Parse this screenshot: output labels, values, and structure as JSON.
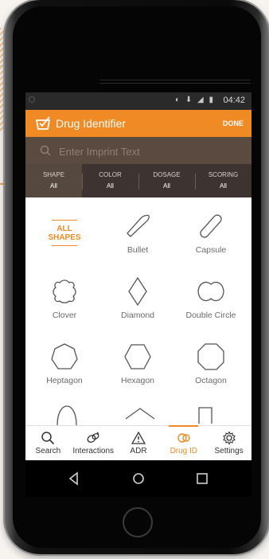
{
  "status": {
    "time": "04:42",
    "icons": "◐ ⬇ ◢ ▮"
  },
  "app": {
    "title": "Drug Identifier",
    "done_label": "DONE",
    "accent": "#f08a24"
  },
  "search": {
    "placeholder": "Enter Imprint Text",
    "value": ""
  },
  "filters": [
    {
      "label": "SHAPE",
      "value": "All"
    },
    {
      "label": "COLOR",
      "value": "All"
    },
    {
      "label": "DOSAGE",
      "value": "All"
    },
    {
      "label": "SCORING",
      "value": "All"
    }
  ],
  "shapes": [
    {
      "label": "ALL\nSHAPES",
      "icon": "none"
    },
    {
      "label": "Bullet",
      "icon": "bullet-icon"
    },
    {
      "label": "Capsule",
      "icon": "capsule-icon"
    },
    {
      "label": "Clover",
      "icon": "clover-icon"
    },
    {
      "label": "Diamond",
      "icon": "diamond-icon"
    },
    {
      "label": "Double Circle",
      "icon": "double-circle-icon"
    },
    {
      "label": "Heptagon",
      "icon": "heptagon-icon"
    },
    {
      "label": "Hexagon",
      "icon": "hexagon-icon"
    },
    {
      "label": "Octagon",
      "icon": "octagon-icon"
    }
  ],
  "tabs": [
    {
      "label": "Search",
      "icon": "search-icon"
    },
    {
      "label": "Interactions",
      "icon": "interactions-icon"
    },
    {
      "label": "ADR",
      "icon": "adr-icon"
    },
    {
      "label": "Drug ID",
      "icon": "drug-id-icon"
    },
    {
      "label": "Settings",
      "icon": "gear-icon"
    }
  ],
  "nav": {
    "back": "◁",
    "home": "○",
    "recents": "□"
  }
}
